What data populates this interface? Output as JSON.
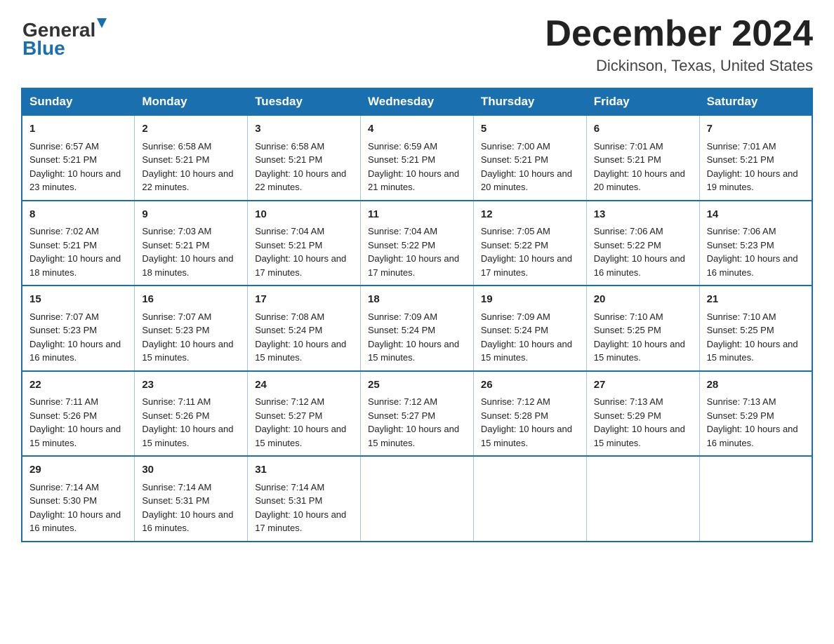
{
  "logo": {
    "general": "General",
    "blue": "Blue",
    "triangle": "▶"
  },
  "title": "December 2024",
  "location": "Dickinson, Texas, United States",
  "days_of_week": [
    "Sunday",
    "Monday",
    "Tuesday",
    "Wednesday",
    "Thursday",
    "Friday",
    "Saturday"
  ],
  "weeks": [
    [
      {
        "day": "1",
        "sunrise": "6:57 AM",
        "sunset": "5:21 PM",
        "daylight": "10 hours and 23 minutes."
      },
      {
        "day": "2",
        "sunrise": "6:58 AM",
        "sunset": "5:21 PM",
        "daylight": "10 hours and 22 minutes."
      },
      {
        "day": "3",
        "sunrise": "6:58 AM",
        "sunset": "5:21 PM",
        "daylight": "10 hours and 22 minutes."
      },
      {
        "day": "4",
        "sunrise": "6:59 AM",
        "sunset": "5:21 PM",
        "daylight": "10 hours and 21 minutes."
      },
      {
        "day": "5",
        "sunrise": "7:00 AM",
        "sunset": "5:21 PM",
        "daylight": "10 hours and 20 minutes."
      },
      {
        "day": "6",
        "sunrise": "7:01 AM",
        "sunset": "5:21 PM",
        "daylight": "10 hours and 20 minutes."
      },
      {
        "day": "7",
        "sunrise": "7:01 AM",
        "sunset": "5:21 PM",
        "daylight": "10 hours and 19 minutes."
      }
    ],
    [
      {
        "day": "8",
        "sunrise": "7:02 AM",
        "sunset": "5:21 PM",
        "daylight": "10 hours and 18 minutes."
      },
      {
        "day": "9",
        "sunrise": "7:03 AM",
        "sunset": "5:21 PM",
        "daylight": "10 hours and 18 minutes."
      },
      {
        "day": "10",
        "sunrise": "7:04 AM",
        "sunset": "5:21 PM",
        "daylight": "10 hours and 17 minutes."
      },
      {
        "day": "11",
        "sunrise": "7:04 AM",
        "sunset": "5:22 PM",
        "daylight": "10 hours and 17 minutes."
      },
      {
        "day": "12",
        "sunrise": "7:05 AM",
        "sunset": "5:22 PM",
        "daylight": "10 hours and 17 minutes."
      },
      {
        "day": "13",
        "sunrise": "7:06 AM",
        "sunset": "5:22 PM",
        "daylight": "10 hours and 16 minutes."
      },
      {
        "day": "14",
        "sunrise": "7:06 AM",
        "sunset": "5:23 PM",
        "daylight": "10 hours and 16 minutes."
      }
    ],
    [
      {
        "day": "15",
        "sunrise": "7:07 AM",
        "sunset": "5:23 PM",
        "daylight": "10 hours and 16 minutes."
      },
      {
        "day": "16",
        "sunrise": "7:07 AM",
        "sunset": "5:23 PM",
        "daylight": "10 hours and 15 minutes."
      },
      {
        "day": "17",
        "sunrise": "7:08 AM",
        "sunset": "5:24 PM",
        "daylight": "10 hours and 15 minutes."
      },
      {
        "day": "18",
        "sunrise": "7:09 AM",
        "sunset": "5:24 PM",
        "daylight": "10 hours and 15 minutes."
      },
      {
        "day": "19",
        "sunrise": "7:09 AM",
        "sunset": "5:24 PM",
        "daylight": "10 hours and 15 minutes."
      },
      {
        "day": "20",
        "sunrise": "7:10 AM",
        "sunset": "5:25 PM",
        "daylight": "10 hours and 15 minutes."
      },
      {
        "day": "21",
        "sunrise": "7:10 AM",
        "sunset": "5:25 PM",
        "daylight": "10 hours and 15 minutes."
      }
    ],
    [
      {
        "day": "22",
        "sunrise": "7:11 AM",
        "sunset": "5:26 PM",
        "daylight": "10 hours and 15 minutes."
      },
      {
        "day": "23",
        "sunrise": "7:11 AM",
        "sunset": "5:26 PM",
        "daylight": "10 hours and 15 minutes."
      },
      {
        "day": "24",
        "sunrise": "7:12 AM",
        "sunset": "5:27 PM",
        "daylight": "10 hours and 15 minutes."
      },
      {
        "day": "25",
        "sunrise": "7:12 AM",
        "sunset": "5:27 PM",
        "daylight": "10 hours and 15 minutes."
      },
      {
        "day": "26",
        "sunrise": "7:12 AM",
        "sunset": "5:28 PM",
        "daylight": "10 hours and 15 minutes."
      },
      {
        "day": "27",
        "sunrise": "7:13 AM",
        "sunset": "5:29 PM",
        "daylight": "10 hours and 15 minutes."
      },
      {
        "day": "28",
        "sunrise": "7:13 AM",
        "sunset": "5:29 PM",
        "daylight": "10 hours and 16 minutes."
      }
    ],
    [
      {
        "day": "29",
        "sunrise": "7:14 AM",
        "sunset": "5:30 PM",
        "daylight": "10 hours and 16 minutes."
      },
      {
        "day": "30",
        "sunrise": "7:14 AM",
        "sunset": "5:31 PM",
        "daylight": "10 hours and 16 minutes."
      },
      {
        "day": "31",
        "sunrise": "7:14 AM",
        "sunset": "5:31 PM",
        "daylight": "10 hours and 17 minutes."
      },
      null,
      null,
      null,
      null
    ]
  ],
  "labels": {
    "sunrise": "Sunrise:",
    "sunset": "Sunset:",
    "daylight": "Daylight:"
  }
}
